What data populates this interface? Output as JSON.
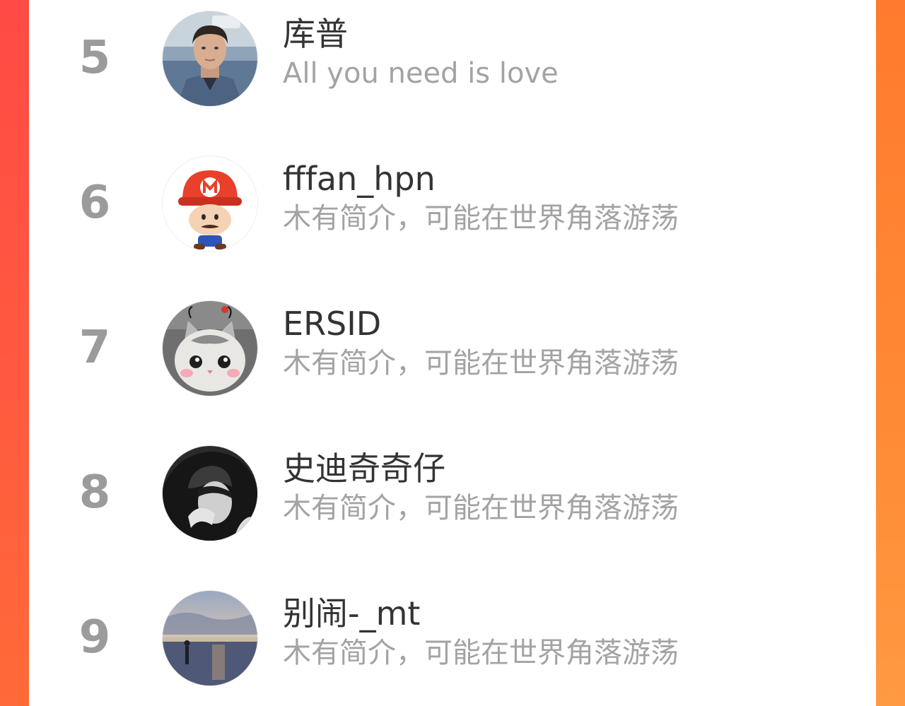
{
  "colors": {
    "frame_left": "#ff4a45",
    "frame_right": "#ff8a35",
    "rank_number": "#9b9b9b",
    "name_text": "#333333",
    "bio_text": "#a3a3a3"
  },
  "ranking": {
    "rows": [
      {
        "rank": "5",
        "name": "库普",
        "bio": "All you need is love",
        "avatar_icon": "man-portrait-avatar"
      },
      {
        "rank": "6",
        "name": "fffan_hpn",
        "bio": "木有简介，可能在世界角落游荡",
        "avatar_icon": "mario-avatar"
      },
      {
        "rank": "7",
        "name": "ERSID",
        "bio": "木有简介，可能在世界角落游荡",
        "avatar_icon": "cat-avatar"
      },
      {
        "rank": "8",
        "name": "史迪奇奇仔",
        "bio": "木有简介，可能在世界角落游荡",
        "avatar_icon": "hooded-person-avatar"
      },
      {
        "rank": "9",
        "name": "别闹-_mt",
        "bio": "木有简介，可能在世界角落游荡",
        "avatar_icon": "beach-sunset-avatar"
      }
    ]
  }
}
